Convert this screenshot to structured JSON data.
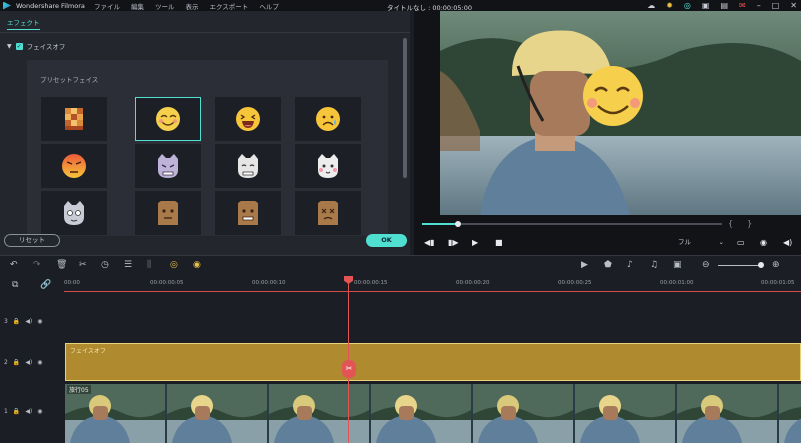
{
  "menubar": {
    "app_name": "Wondershare Filmora",
    "menus": [
      "ファイル",
      "編集",
      "ツール",
      "表示",
      "エクスポート",
      "ヘルプ"
    ],
    "project_title": "タイトルなし : 00:00:05:00",
    "icons": [
      "cloud-icon",
      "bulb-icon",
      "headset-icon",
      "profile-icon",
      "save-icon",
      "mail-icon",
      "minimize-icon",
      "maximize-icon",
      "close-icon"
    ]
  },
  "left_panel": {
    "tab": "エフェクト",
    "tree_item": "フェイスオフ",
    "preset_title": "プリセットフェイス",
    "reset_label": "リセット",
    "ok_label": "OK",
    "faces": [
      {
        "name": "pixel-face"
      },
      {
        "name": "smile-face",
        "selected": true
      },
      {
        "name": "laugh-face"
      },
      {
        "name": "tear-face"
      },
      {
        "name": "angry-face"
      },
      {
        "name": "cat-angry-face"
      },
      {
        "name": "cat-face"
      },
      {
        "name": "cat-shy-face"
      },
      {
        "name": "cat-gray-face"
      },
      {
        "name": "bag-face"
      },
      {
        "name": "bag-grin-face"
      },
      {
        "name": "bag-dizzy-face"
      }
    ]
  },
  "preview": {
    "progress_fraction": 0.12,
    "quality": "フル",
    "controls": [
      "prev-frame-icon",
      "play-step-icon",
      "play-icon",
      "stop-icon"
    ],
    "right_icons": [
      "monitor-icon",
      "snapshot-icon",
      "volume-icon"
    ]
  },
  "toolbar": {
    "left_icons": [
      "undo-icon",
      "redo-icon",
      "delete-icon",
      "cut-icon",
      "speed-icon",
      "adjust-icon",
      "audio-icon",
      "color-icon",
      "stabilize-icon"
    ],
    "right_icons": [
      "render-icon",
      "marker-icon",
      "mic-icon",
      "music-icon",
      "subtitle-icon",
      "zoom-out-icon",
      "zoom-in-icon"
    ]
  },
  "timeline": {
    "ticks": [
      "00:00",
      "00:00:00:05",
      "00:00:00:10",
      "00:00:00:15",
      "00:00:00:20",
      "00:00:00:25",
      "00:00:01:00",
      "00:00:01:05"
    ],
    "tracks": [
      {
        "label": "3"
      },
      {
        "label": "2",
        "clip": "フェイスオフ"
      },
      {
        "label": "1",
        "clip": "旅行05"
      }
    ]
  },
  "colors": {
    "accent": "#4fe0d2",
    "playhead": "#e35555",
    "effect_clip": "#b08a2e"
  }
}
